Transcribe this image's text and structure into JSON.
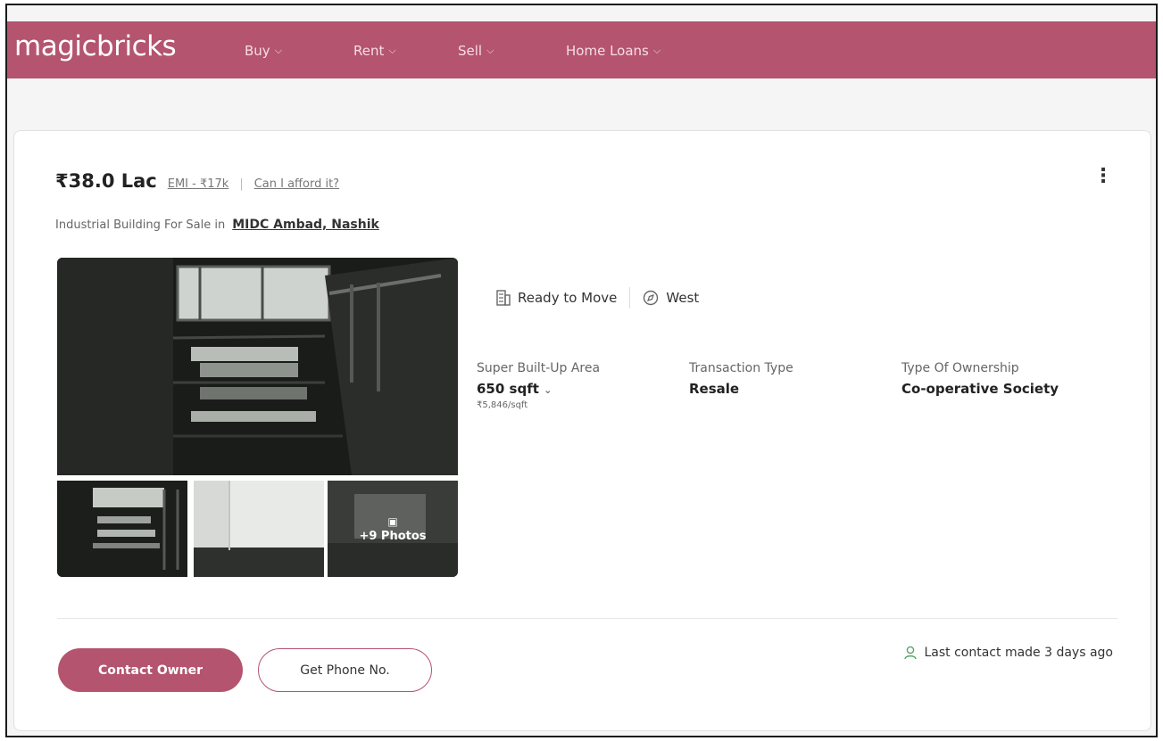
{
  "header": {
    "logo": "magicbricks",
    "nav": [
      {
        "label": "Buy"
      },
      {
        "label": "Rent"
      },
      {
        "label": "Sell"
      },
      {
        "label": "Home Loans"
      }
    ]
  },
  "listing": {
    "price": "₹38.0 Lac",
    "emi": "EMI - ₹17k",
    "separator": "|",
    "afford_link": "Can I afford it?",
    "title_prefix": "Industrial Building For Sale in",
    "locality": "MIDC Ambad, Nashik",
    "photos_overlay": "+9 Photos",
    "chips": [
      {
        "label": "Ready to Move",
        "icon": "building-icon"
      },
      {
        "label": "West",
        "icon": "compass-icon"
      }
    ],
    "specs": [
      {
        "label": "Super Built-Up Area",
        "value": "650 sqft",
        "sub": "₹5,846/sqft"
      },
      {
        "label": "Transaction Type",
        "value": "Resale"
      },
      {
        "label": "Type Of Ownership",
        "value": "Co-operative Society"
      }
    ],
    "contact_button": "Contact Owner",
    "phone_button": "Get Phone No.",
    "last_contact": "Last contact made 3 days ago"
  },
  "colors": {
    "brand": "#b4546f",
    "accent_green": "#5aa36a"
  }
}
